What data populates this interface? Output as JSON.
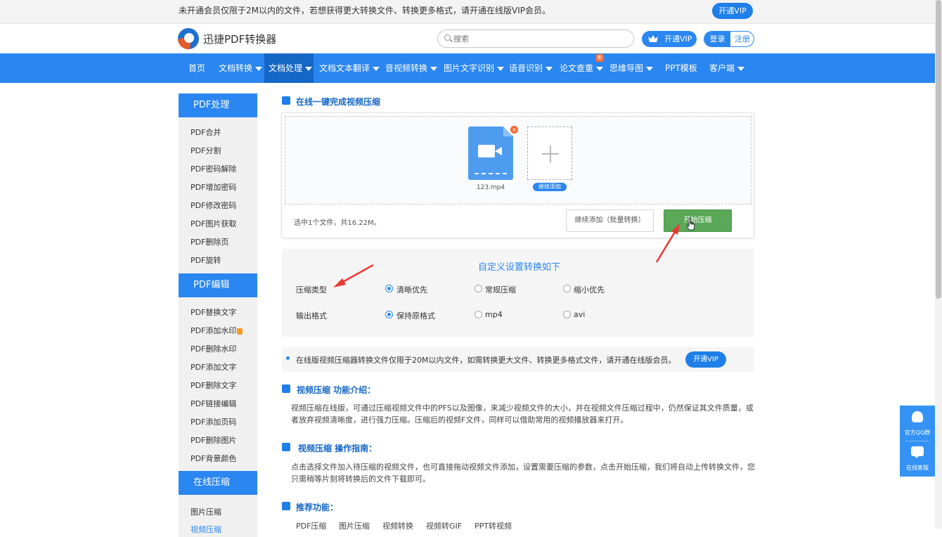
{
  "topbar": {
    "notice": "未开通会员仅限于2M以内的文件，若想获得更大转换文件、转换更多格式，请开通在线版VIP会员。",
    "vip_button": "开通VIP"
  },
  "header": {
    "brand": "迅捷PDF转换器",
    "search_placeholder": "搜索",
    "vip_button": "开通VIP",
    "login": "登录",
    "register": "注册"
  },
  "nav": {
    "items": [
      {
        "label": "首页",
        "dropdown": false
      },
      {
        "label": "文档转换",
        "dropdown": true
      },
      {
        "label": "文档处理",
        "dropdown": true,
        "active": true
      },
      {
        "label": "文档文本翻译",
        "dropdown": true
      },
      {
        "label": "音视频转换",
        "dropdown": true
      },
      {
        "label": "图片文字识别",
        "dropdown": true
      },
      {
        "label": "语音识别",
        "dropdown": true
      },
      {
        "label": "论文查重",
        "dropdown": true,
        "badge": "新"
      },
      {
        "label": "思维导图",
        "dropdown": true
      },
      {
        "label": "PPT模板",
        "dropdown": false
      },
      {
        "label": "客户端",
        "dropdown": true
      }
    ]
  },
  "sidebar": {
    "groups": [
      {
        "title": "PDF处理",
        "items": [
          "PDF合并",
          "PDF分割",
          "PDF密码解除",
          "PDF增加密码",
          "PDF修改密码",
          "PDF图片获取",
          "PDF删除页",
          "PDF旋转"
        ]
      },
      {
        "title": "PDF编辑",
        "items": [
          "PDF替换文字",
          "PDF添加水印",
          "PDF删除水印",
          "PDF添加文字",
          "PDF删除文字",
          "PDF链接编辑",
          "PDF添加页码",
          "PDF删除图片",
          "PDF背景颜色"
        ]
      },
      {
        "title": "在线压缩",
        "items": [
          "图片压缩",
          "视频压缩"
        ]
      }
    ]
  },
  "main": {
    "title": "在线一键完成视频压缩",
    "file": {
      "name": "123.mp4",
      "remove_icon": "×"
    },
    "add_more_label": "继续添加",
    "selection_info": "选中1个文件，共16.22M。",
    "batch_button": "继续添加（批量转换）",
    "start_button": "开始压缩",
    "settings": {
      "title": "自定义设置转换如下",
      "compress_type_label": "压缩类型",
      "compress_options": [
        "清晰优先",
        "常规压缩",
        "缩小优先"
      ],
      "compress_selected": "清晰优先",
      "output_label": "输出格式",
      "output_options": [
        "保持原格式",
        "mp4",
        "avi"
      ],
      "output_selected": "保持原格式"
    },
    "info": {
      "text": "在线版视频压缩器转换文件仅限于20M以内文件，如需转换更大文件、转换更多格式文件，请开通在线版会员。",
      "vip_button": "开通VIP"
    },
    "intro": {
      "title": "视频压缩 功能介绍：",
      "text": "视频压缩在线版，可通过压缩视频文件中的PFS以及图像，来减少视频文件的大小，并在视频文件压缩过程中，仍然保证其文件质量，或者放弃视频清晰度，进行强力压缩。压缩后的视频F文件，同样可以借助常用的视频播放器来打开。"
    },
    "guide": {
      "title": "视频压缩 操作指南：",
      "text": "点击选择文件加入待压缩的视频文件，也可直接拖动视频文件添加，设置需要压缩的参数，点击开始压缩，我们将自动上传转换文件，您只需稍等片刻将转换后的文件下载即可。"
    },
    "recommend": {
      "title": "推荐功能：",
      "items": [
        "PDF压缩",
        "图片压缩",
        "视频转换",
        "视频转GIF",
        "PPT转视频"
      ]
    }
  },
  "float": {
    "qq_label": "官方QQ群",
    "service_label": "在线客服"
  },
  "colors": {
    "primary": "#2a86f0",
    "nav_active": "#1667c5",
    "start_button": "#5aa858",
    "annotation_arrow": "#e83a33"
  }
}
